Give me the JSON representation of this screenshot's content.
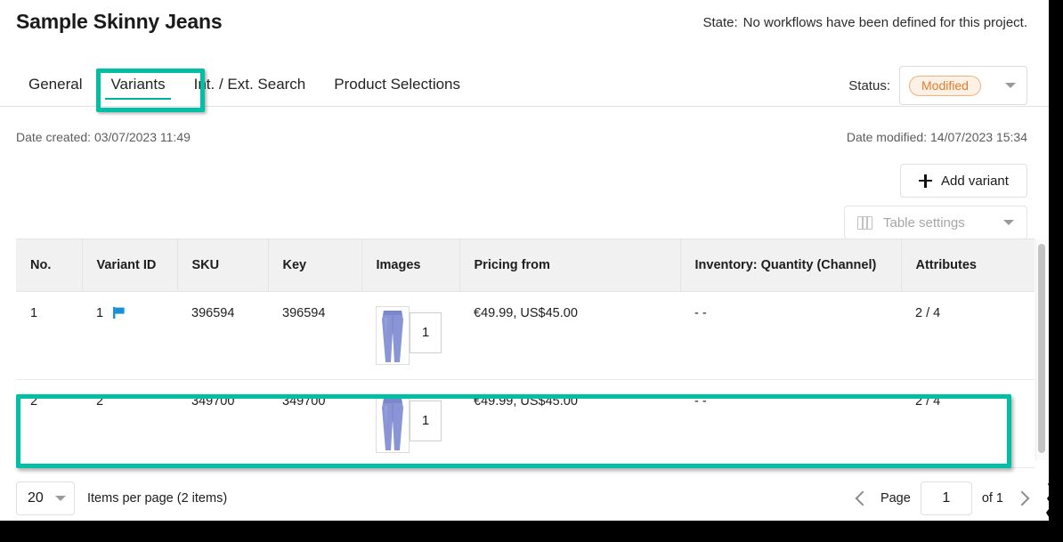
{
  "header": {
    "title": "Sample Skinny Jeans",
    "state_label": "State:",
    "state_value": "No workflows have been defined for this project.",
    "status_label": "Status:",
    "status_value": "Modified"
  },
  "tabs": [
    {
      "label": "General",
      "active": false
    },
    {
      "label": "Variants",
      "active": true
    },
    {
      "label": "Int. / Ext. Search",
      "active": false
    },
    {
      "label": "Product Selections",
      "active": false
    }
  ],
  "meta": {
    "date_created": "Date created: 03/07/2023 11:49",
    "date_modified": "Date modified: 14/07/2023 15:34"
  },
  "actions": {
    "add_variant": "Add variant",
    "table_settings": "Table settings"
  },
  "table": {
    "columns": [
      "No.",
      "Variant ID",
      "SKU",
      "Key",
      "Images",
      "Pricing from",
      "Inventory: Quantity (Channel)",
      "Attributes"
    ],
    "rows": [
      {
        "no": "1",
        "variant_id": "1",
        "flagged": true,
        "sku": "396594",
        "key": "396594",
        "image_count": "1",
        "pricing": "€49.99, US$45.00",
        "inventory": "- -",
        "attributes": "2 / 4",
        "highlighted": false
      },
      {
        "no": "2",
        "variant_id": "2",
        "flagged": false,
        "sku": "349700",
        "key": "349700",
        "image_count": "1",
        "pricing": "€49.99, US$45.00",
        "inventory": "- -",
        "attributes": "2 / 4",
        "highlighted": true
      }
    ]
  },
  "footer": {
    "per_page_value": "20",
    "per_page_text": "Items per page (2 items)",
    "page_label": "Page",
    "page_value": "1",
    "page_of": "of 1"
  },
  "colors": {
    "accent_teal": "#00bfa5",
    "tab_underline": "#00b3a0",
    "badge_text": "#e07c2b",
    "badge_bg": "#fdf0e4",
    "flag_blue": "#1890d8"
  }
}
